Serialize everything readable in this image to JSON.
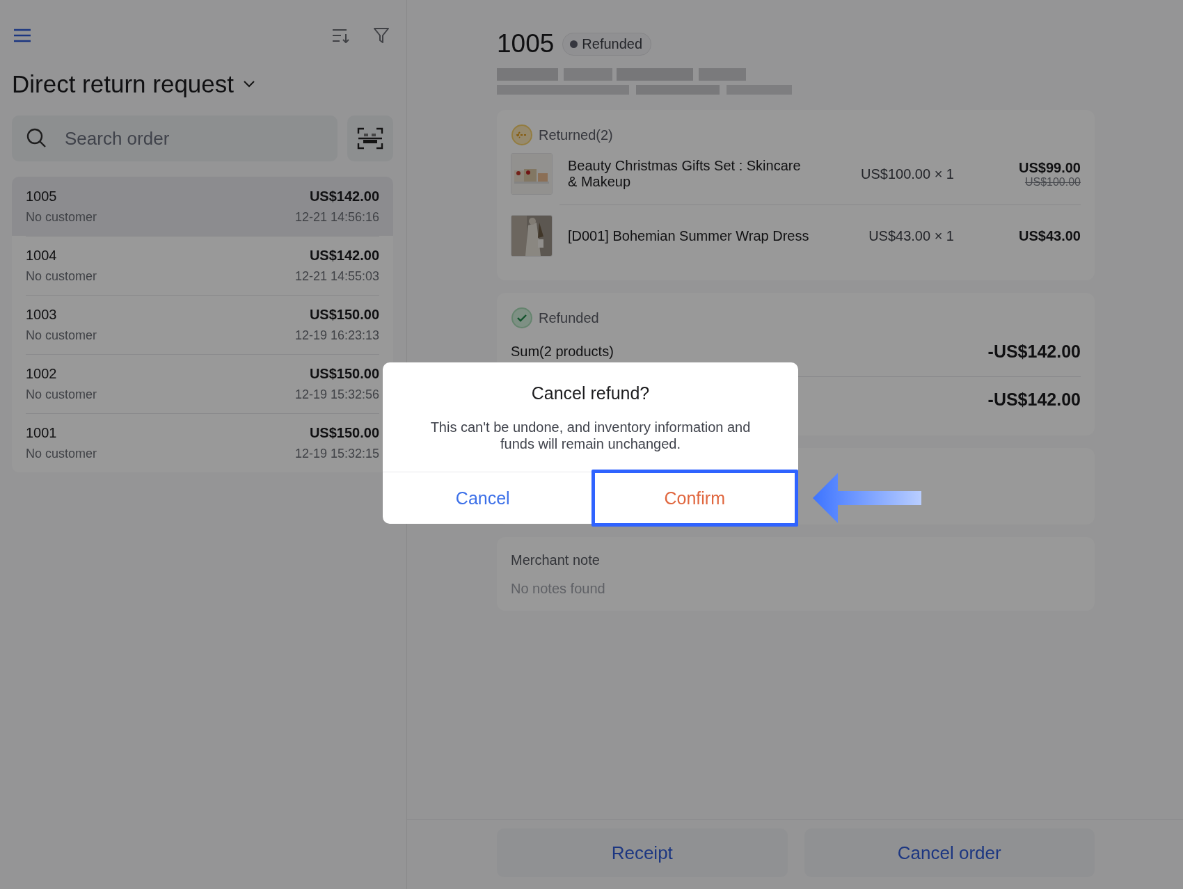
{
  "sidebar": {
    "title": "Direct return request",
    "search": {
      "placeholder": "Search order"
    },
    "orders": [
      {
        "number": "1005",
        "amount": "US$142.00",
        "customer": "No customer",
        "time": "12-21 14:56:16",
        "selected": true
      },
      {
        "number": "1004",
        "amount": "US$142.00",
        "customer": "No customer",
        "time": "12-21 14:55:03",
        "selected": false
      },
      {
        "number": "1003",
        "amount": "US$150.00",
        "customer": "No customer",
        "time": "12-19 16:23:13",
        "selected": false
      },
      {
        "number": "1002",
        "amount": "US$150.00",
        "customer": "No customer",
        "time": "12-19 15:32:56",
        "selected": false
      },
      {
        "number": "1001",
        "amount": "US$150.00",
        "customer": "No customer",
        "time": "12-19 15:32:15",
        "selected": false
      }
    ]
  },
  "detail": {
    "order_number": "1005",
    "status": "Refunded",
    "returned": {
      "title": "Returned(2)",
      "items": [
        {
          "name": "Beauty Christmas Gifts Set : Skincare & Makeup",
          "unit_price": "US$100.00 × 1",
          "price": "US$99.00",
          "original_price": "US$100.00"
        },
        {
          "name": "[D001] Bohemian Summer Wrap Dress",
          "unit_price": "US$43.00 × 1",
          "price": "US$43.00"
        }
      ]
    },
    "refunded": {
      "title": "Refunded",
      "rows": [
        {
          "label": "Sum(2 products)",
          "amount": "-US$142.00"
        },
        {
          "amount": "-US$142.00"
        }
      ]
    },
    "merchant_note": {
      "title": "Merchant note",
      "text": "No notes found"
    },
    "actions": [
      "Receipt",
      "Cancel order"
    ]
  },
  "dialog": {
    "title": "Cancel refund?",
    "message": "This can't be undone, and inventory information and funds will remain unchanged.",
    "buttons": [
      {
        "label": "Cancel",
        "kind": "cancel",
        "highlighted": false
      },
      {
        "label": "Confirm",
        "kind": "confirm",
        "highlighted": true
      }
    ]
  }
}
